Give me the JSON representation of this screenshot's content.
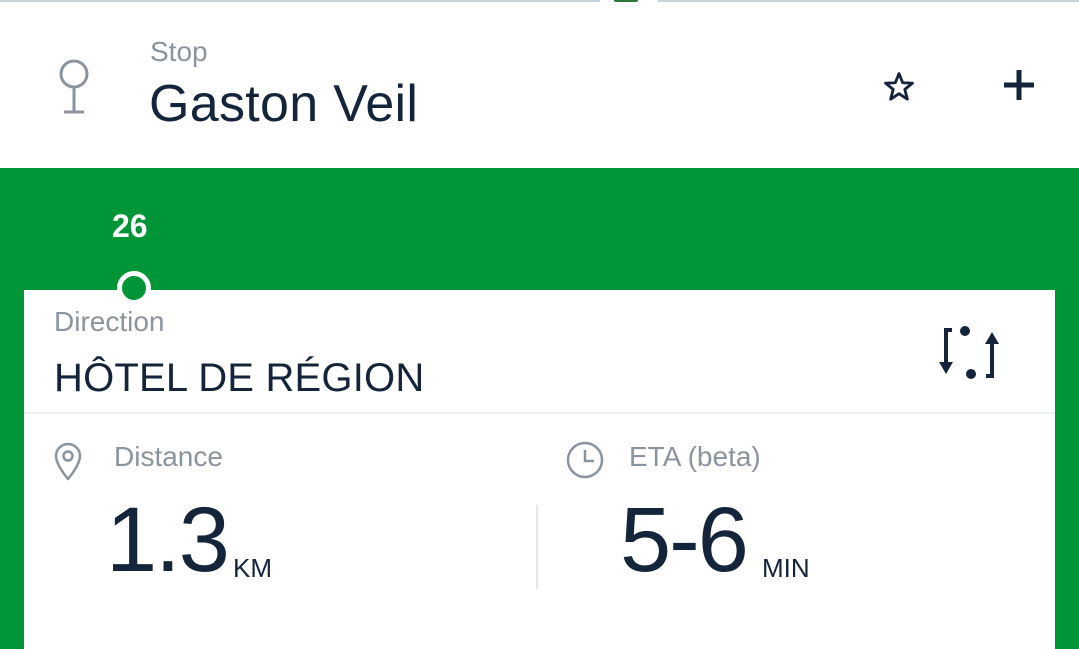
{
  "stop": {
    "caption": "Stop",
    "name": "Gaston Veil",
    "icon": "stop-pin-icon"
  },
  "actions": {
    "favorite_icon": "star-outline-icon",
    "add_icon": "plus-icon"
  },
  "line": {
    "number": "26",
    "color": "#009536"
  },
  "direction": {
    "caption": "Direction",
    "name": "HÔTEL DE RÉGION",
    "swap_icon": "swap-direction-icon"
  },
  "distance": {
    "caption": "Distance",
    "value": "1.3",
    "unit": "KM",
    "icon": "location-pin-icon"
  },
  "eta": {
    "caption": "ETA (beta)",
    "value": "5-6",
    "unit": "MIN",
    "icon": "clock-icon"
  },
  "colors": {
    "text_primary": "#14243a",
    "text_secondary": "#8a949e",
    "accent_green": "#009536"
  }
}
